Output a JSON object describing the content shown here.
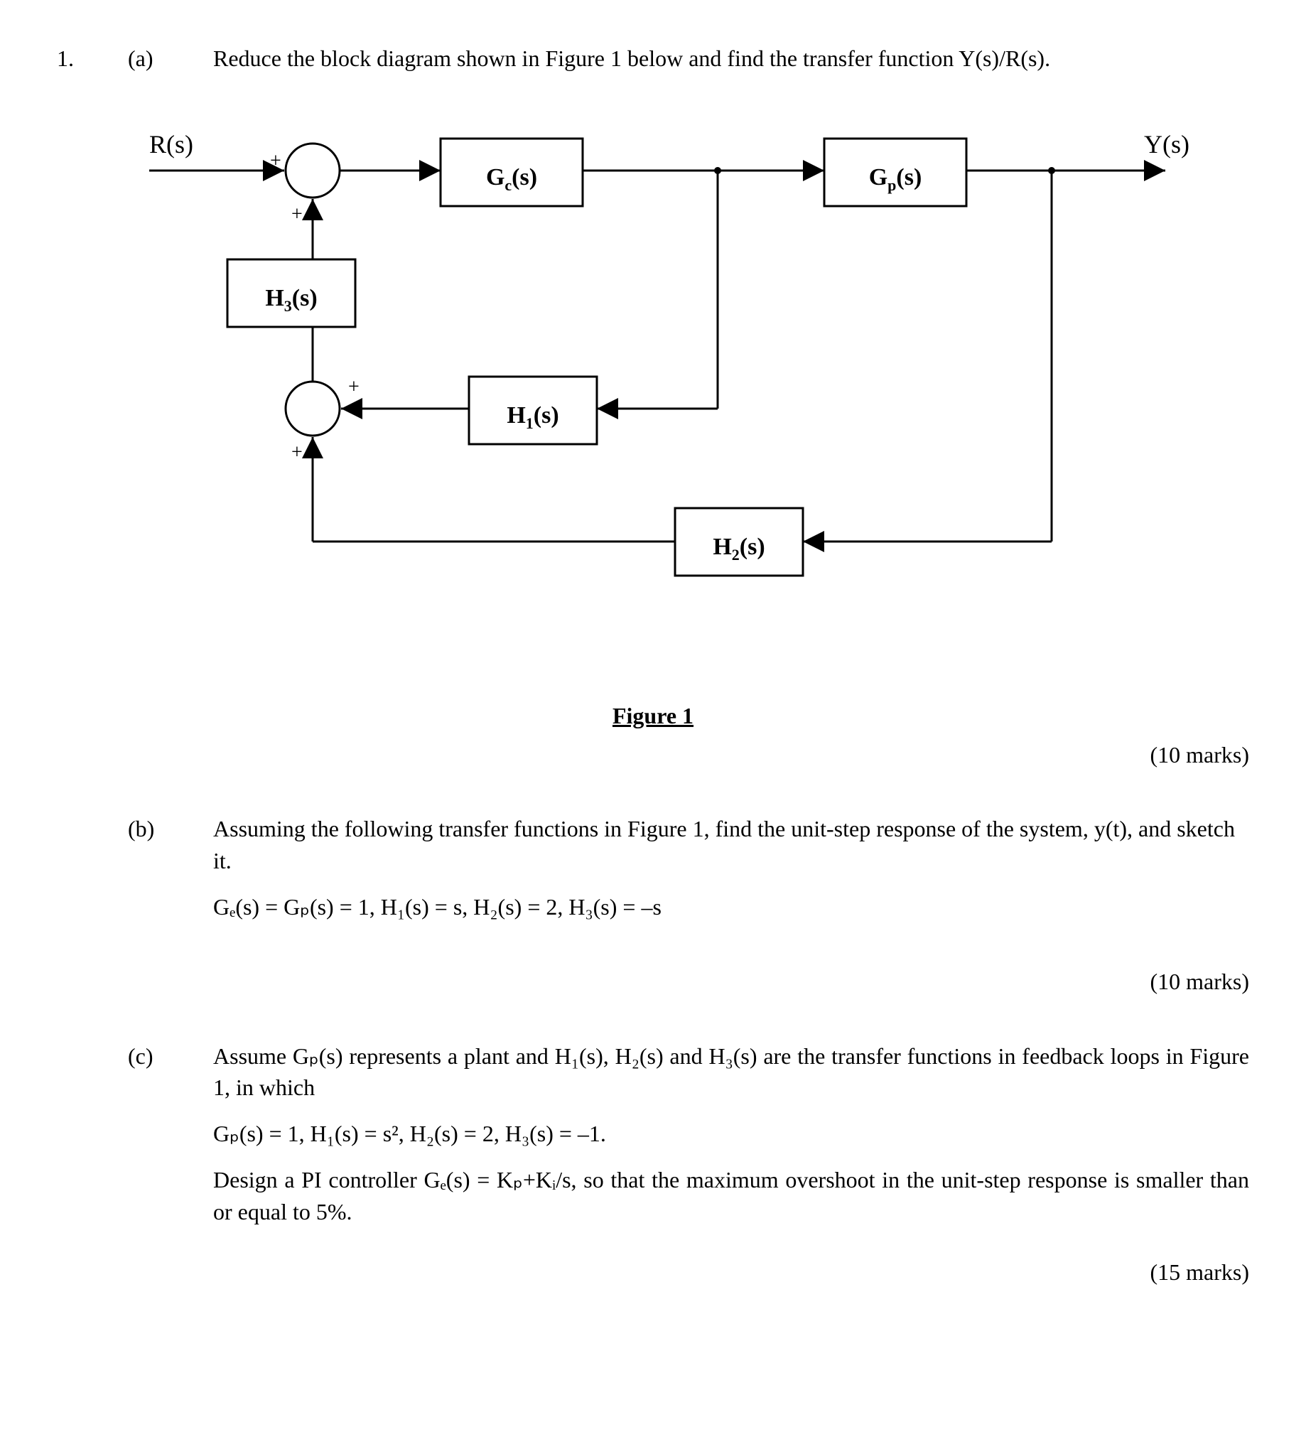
{
  "q_number": "1.",
  "parts": {
    "a": {
      "label": "(a)",
      "text": "Reduce the block diagram shown in Figure 1 below and find the transfer function Y(s)/R(s).",
      "marks": "(10 marks)"
    },
    "b": {
      "label": "(b)",
      "text": "Assuming the following transfer functions in Figure 1, find the unit-step response of the system, y(t), and sketch it.",
      "eq": "Gₑ(s) = Gₚ(s) = 1, H₁(s) = s, H₂(s) = 2, H₃(s) = –s",
      "marks": "(10 marks)"
    },
    "c": {
      "label": "(c)",
      "text": "Assume Gₚ(s) represents a plant and H₁(s), H₂(s) and H₃(s) are the transfer functions in feedback loops in Figure 1, in which",
      "eq": "Gₚ(s) = 1, H₁(s) = s², H₂(s) = 2, H₃(s) = –1.",
      "text2": "Design a PI controller Gₑ(s) = Kₚ+Kᵢ/s, so that the maximum overshoot in the unit-step response is smaller than or equal to 5%.",
      "marks": "(15 marks)"
    }
  },
  "figure": {
    "caption": "Figure 1",
    "input": "R(s)",
    "output": "Y(s)",
    "blocks": {
      "Gc": "Gₑ(s)",
      "Gp": "Gₚ(s)",
      "H1": "H₁(s)",
      "H2": "H₂(s)",
      "H3": "H₃(s)"
    },
    "signs": {
      "sum1_top": "+",
      "sum1_bottom": "+",
      "sum2_top": "+",
      "sum2_bottom": "+"
    }
  }
}
